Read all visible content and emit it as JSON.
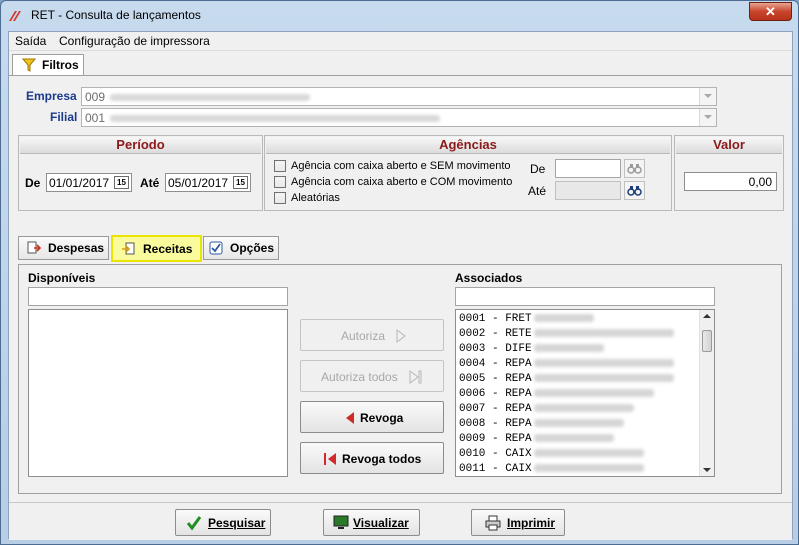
{
  "window": {
    "title": "RET - Consulta de lançamentos",
    "close_glyph": "✕"
  },
  "menu": {
    "items": [
      "Saída",
      "Configuração de impressora"
    ]
  },
  "tabs": {
    "filtros": "Filtros"
  },
  "empresa": {
    "label": "Empresa",
    "code": "009"
  },
  "filial": {
    "label": "Filial",
    "code": "001"
  },
  "periodo": {
    "title": "Período",
    "de_label": "De",
    "de_value": "01/01/2017",
    "ate_label": "Até",
    "ate_value": "05/01/2017",
    "cal_glyph": "15"
  },
  "agencias": {
    "title": "Agências",
    "options": [
      "Agência com caixa aberto e SEM movimento",
      "Agência com caixa aberto e COM movimento",
      "Aleatórias"
    ],
    "de_label": "De",
    "ate_label": "Até"
  },
  "valor": {
    "title": "Valor",
    "value": "0,00"
  },
  "subtabs": {
    "despesas": "Despesas",
    "receitas": "Receitas",
    "opcoes": "Opções",
    "active": "receitas"
  },
  "disponiveis": {
    "label": "Disponíveis"
  },
  "associados": {
    "label": "Associados",
    "items": [
      "0001 - FRET",
      "0002 - RETE",
      "0003 - DIFE",
      "0004 - REPA",
      "0005 - REPA",
      "0006 - REPA",
      "0007 - REPA",
      "0008 - REPA",
      "0009 - REPA",
      "0010 - CAIX",
      "0011 - CAIX"
    ]
  },
  "actions": {
    "autoriza": "Autoriza",
    "autoriza_todos": "Autoriza todos",
    "revoga": "Revoga",
    "revoga_todos": "Revoga todos"
  },
  "bottom": {
    "pesquisar": "Pesquisar",
    "visualizar": "Visualizar",
    "imprimir": "Imprimir"
  },
  "colors": {
    "title_red": "#8b1a1a",
    "label_blue": "#1a3a8c",
    "highlight": "#fafb9c",
    "highlight_border": "#e9e500"
  }
}
